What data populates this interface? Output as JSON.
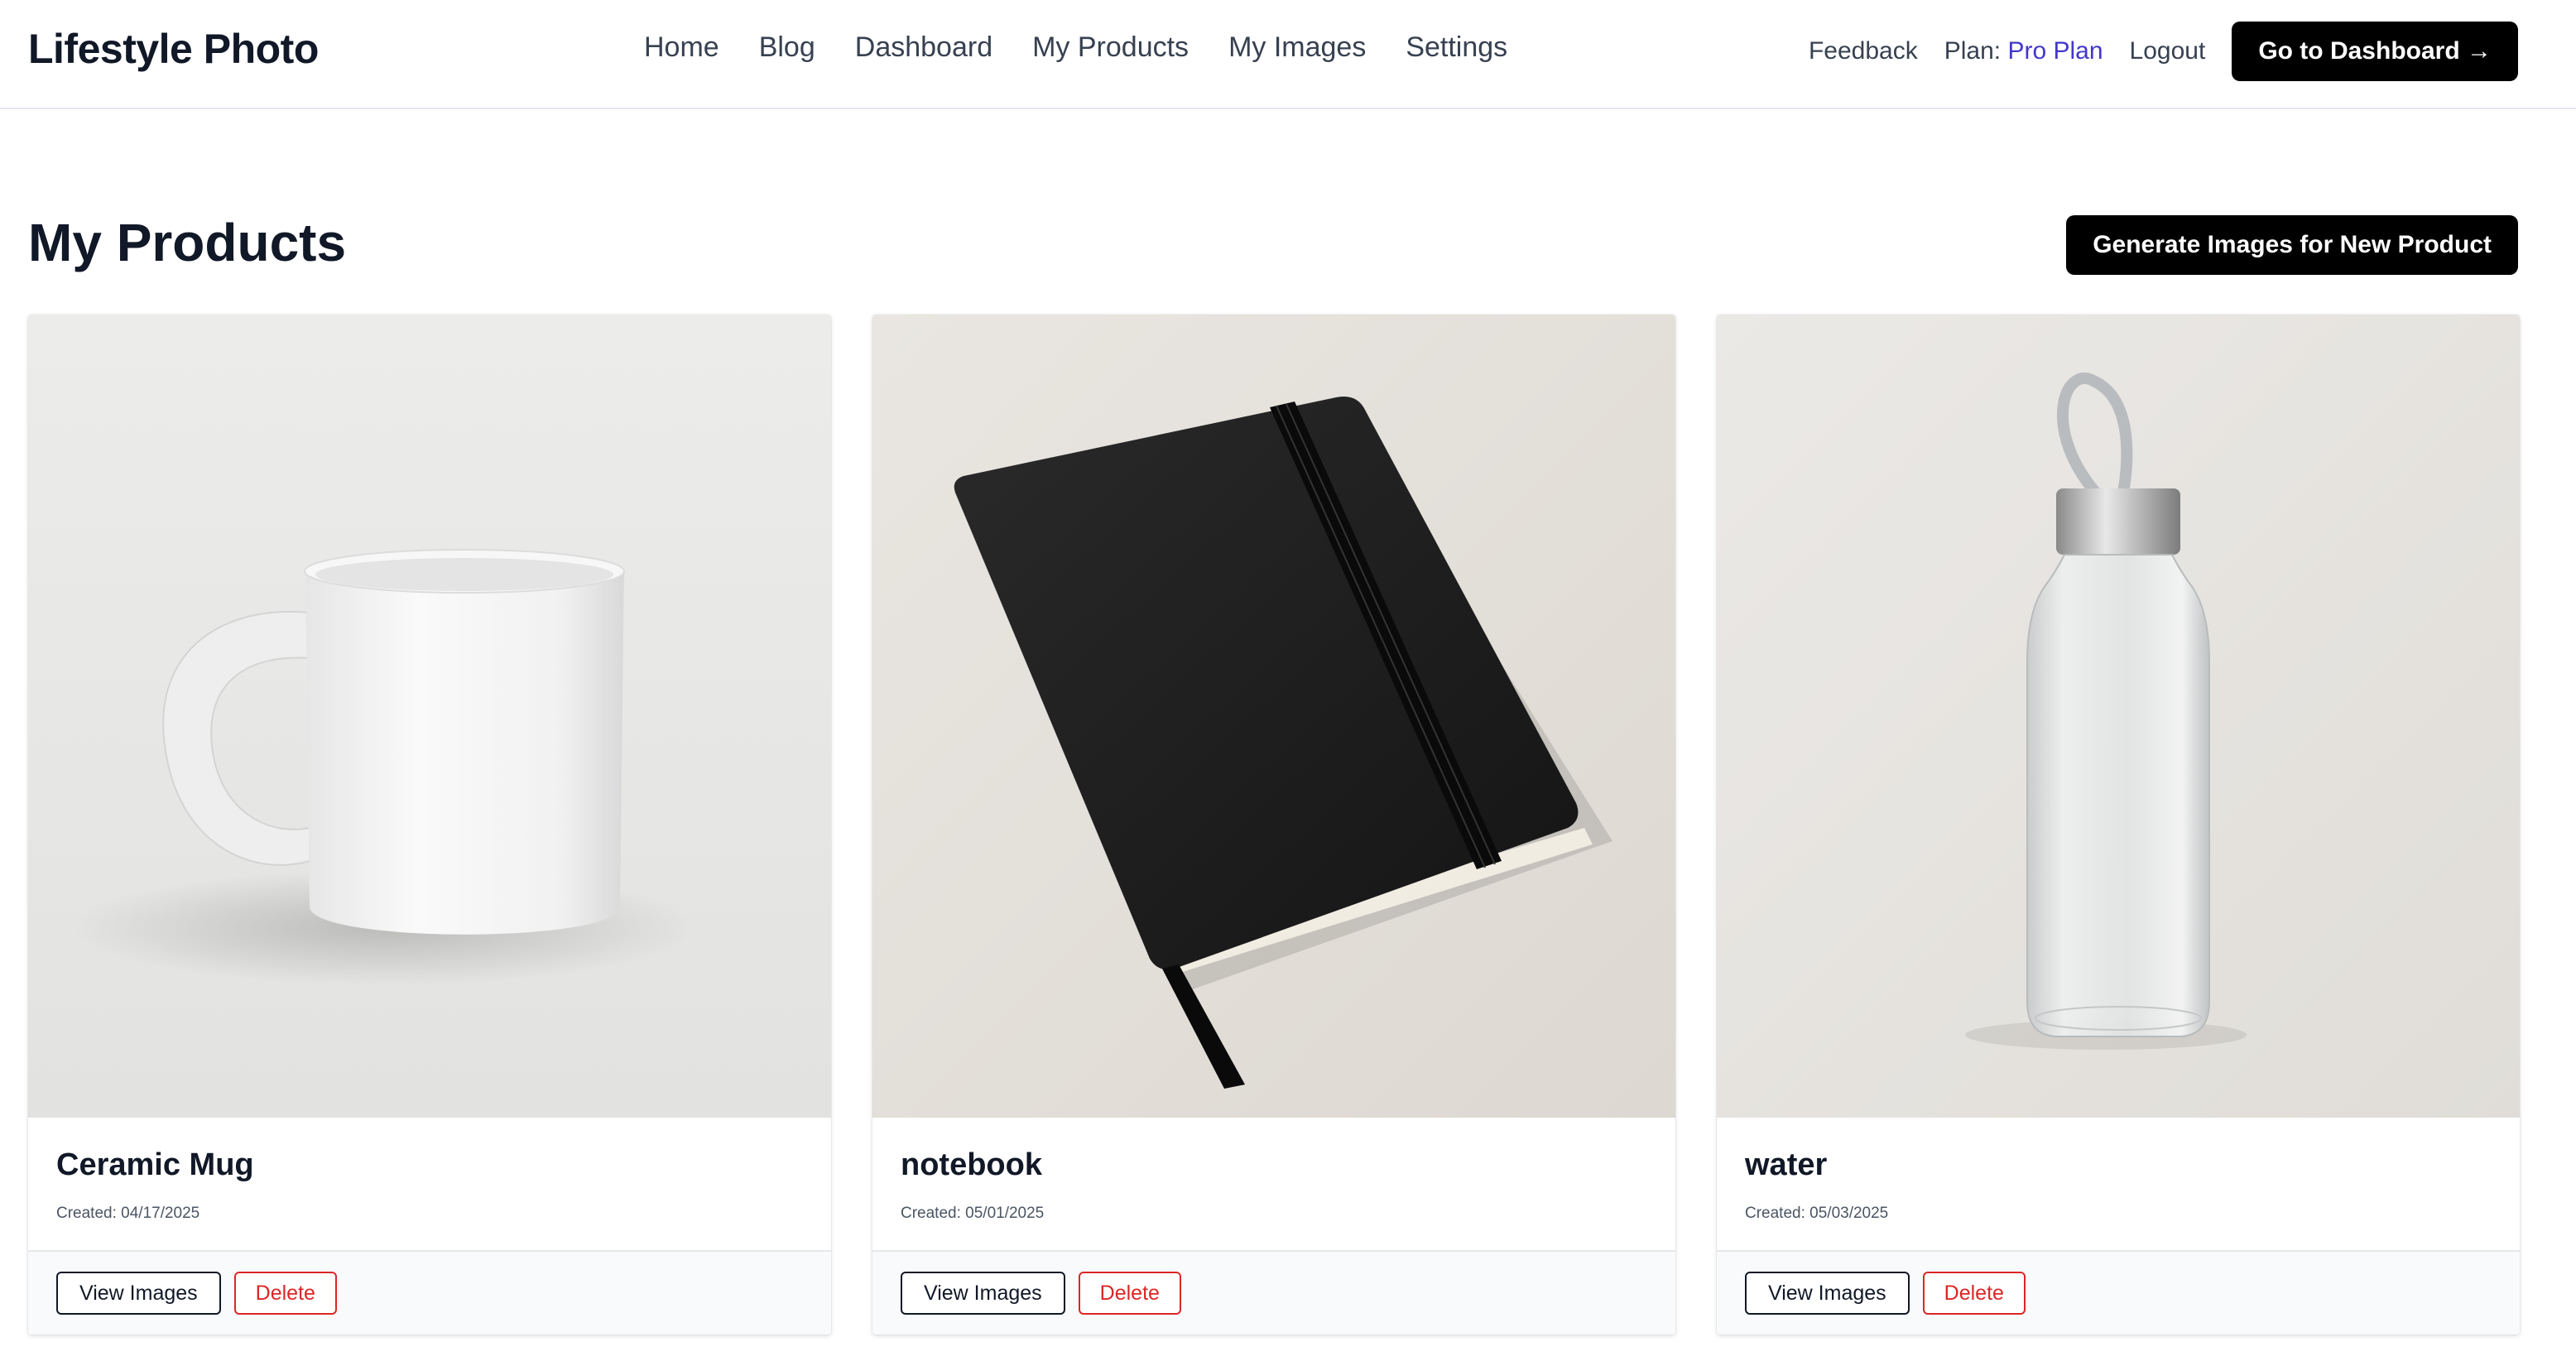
{
  "header": {
    "brand": "Lifestyle Photo",
    "nav": [
      "Home",
      "Blog",
      "Dashboard",
      "My Products",
      "My Images",
      "Settings"
    ],
    "feedback": "Feedback",
    "plan_label": "Plan:",
    "plan_name": "Pro Plan",
    "logout": "Logout",
    "dashboard_button": "Go to Dashboard →"
  },
  "page": {
    "title": "My Products",
    "generate_button": "Generate Images for New Product"
  },
  "products": [
    {
      "name": "Ceramic Mug",
      "created": "Created: 04/17/2025",
      "view_label": "View Images",
      "delete_label": "Delete",
      "image_icon": "mug-image"
    },
    {
      "name": "notebook",
      "created": "Created: 05/01/2025",
      "view_label": "View Images",
      "delete_label": "Delete",
      "image_icon": "notebook-image"
    },
    {
      "name": "water",
      "created": "Created: 05/03/2025",
      "view_label": "View Images",
      "delete_label": "Delete",
      "image_icon": "bottle-image"
    }
  ],
  "colors": {
    "accent_plan": "#4338ca",
    "danger": "#dc2626",
    "primary_button": "#000000"
  }
}
